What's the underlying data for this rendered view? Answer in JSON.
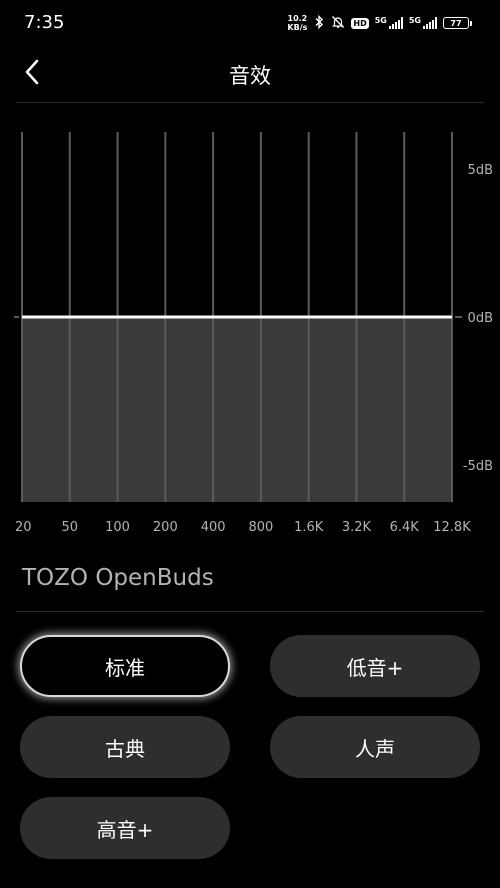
{
  "status_bar": {
    "time": "7:35",
    "net_speed_value": "10.2",
    "net_speed_unit": "KB/s",
    "bluetooth_icon": "bluetooth-icon",
    "mute_icon": "mute-bell-icon",
    "hd_label": "HD",
    "sim1_label": "5G",
    "sim2_label": "5G",
    "battery": "77"
  },
  "header": {
    "back_icon": "chevron-left-icon",
    "title": "音效"
  },
  "equalizer": {
    "band_labels": [
      "20",
      "50",
      "100",
      "200",
      "400",
      "800",
      "1.6K",
      "3.2K",
      "6.4K",
      "12.8K"
    ],
    "band_gains_db": [
      0,
      0,
      0,
      0,
      0,
      0,
      0,
      0,
      0,
      0
    ],
    "db_labels": [
      "5dB",
      "0dB",
      "-5dB"
    ],
    "db_range": [
      -6.25,
      6.25
    ]
  },
  "device": {
    "name": "TOZO OpenBuds"
  },
  "presets": [
    {
      "label": "标准",
      "active": true
    },
    {
      "label": "低音+",
      "active": false
    },
    {
      "label": "古典",
      "active": false
    },
    {
      "label": "人声",
      "active": false
    },
    {
      "label": "高音+",
      "active": false
    }
  ],
  "colors": {
    "background": "#000000",
    "curve": "#ffffff",
    "fill": "#3a3a3a",
    "band_line": "#5a5a5a",
    "button_bg": "#2e2e2e",
    "text_secondary": "#b3b3b3"
  }
}
